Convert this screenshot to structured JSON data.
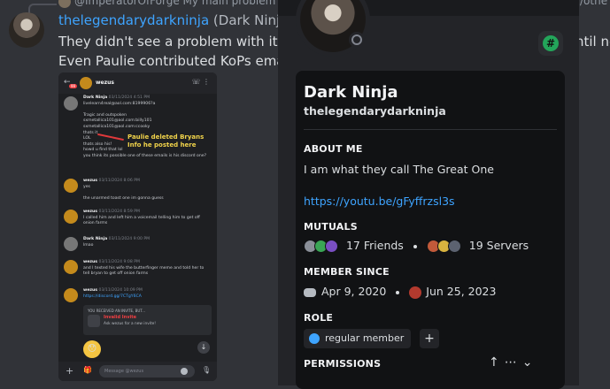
{
  "reply": {
    "name": "@ImperatorOfForge",
    "text": "My main problem"
  },
  "message": {
    "username": "thelegendarydarkninja",
    "display_name": "(Dark Ninja)",
    "line1": "They didn't see a problem with it bac",
    "line2": "Even Paulie contributed KoPs email a",
    "clip_right": "ntil ne",
    "clip_right_top": "/othe"
  },
  "screenshot": {
    "header_name": "wezus",
    "badge": "99",
    "annotation": [
      "Paulie deleted Bryans",
      "Info he posted here"
    ],
    "msgs": [
      {
        "author": "Dark Ninja",
        "ts": "03/11/2024 4:51 PM",
        "lines": [
          "livelearn4real@aol.com:8199906?a",
          "",
          "Tragic and outspoken",
          "sxmetallica101@aol.com:billy101",
          "sxmetallica101@aol.com:ccooky",
          "thats it",
          "LOL",
          "thats also his!",
          "howd u find that lol",
          "you think its possible one of these emails is his discord one?"
        ]
      },
      {
        "author": "wezus",
        "ts": "03/11/2024 8:06 PM",
        "lines": [
          "yes",
          "",
          "the unarmed toast one im gonna guess"
        ]
      },
      {
        "author": "wezus",
        "ts": "03/11/2024 8:59 PM",
        "lines": [
          "I called him and left him a voicemail telling him to get off",
          "onion farms"
        ]
      },
      {
        "author": "Dark Ninja",
        "ts": "03/11/2024 9:00 PM",
        "lines": [
          "lmao"
        ]
      },
      {
        "author": "wezus",
        "ts": "03/11/2024 9:08 PM",
        "lines": [
          "and I texted his wife the butterfinger meme and told her to",
          "tell bryan to get off onion farms"
        ]
      },
      {
        "author": "wezus",
        "ts": "03/11/2024 10:09 PM",
        "lines": [
          "https://discord.gg/7CTgY6CA"
        ]
      }
    ],
    "invite_header": "YOU RECEIVED AN INVITE, BUT...",
    "invite_title": "Invalid Invite",
    "invite_sub": "Ask wezus for a new invite!",
    "input_placeholder": "Message @wezus"
  },
  "profile": {
    "display_name": "Dark Ninja",
    "username": "thelegendarydarkninja",
    "about_label": "ABOUT ME",
    "about_text": "I am what they call The Great One",
    "about_link": "https://youtu.be/gFyffrzsl3s",
    "mutuals_label": "MUTUALS",
    "friends": "17 Friends",
    "servers": "19 Servers",
    "member_since_label": "MEMBER SINCE",
    "discord_date": "Apr 9, 2020",
    "server_date": "Jun 25, 2023",
    "role_label": "ROLE",
    "role_name": "regular member",
    "permissions_label": "PERMISSIONS"
  }
}
